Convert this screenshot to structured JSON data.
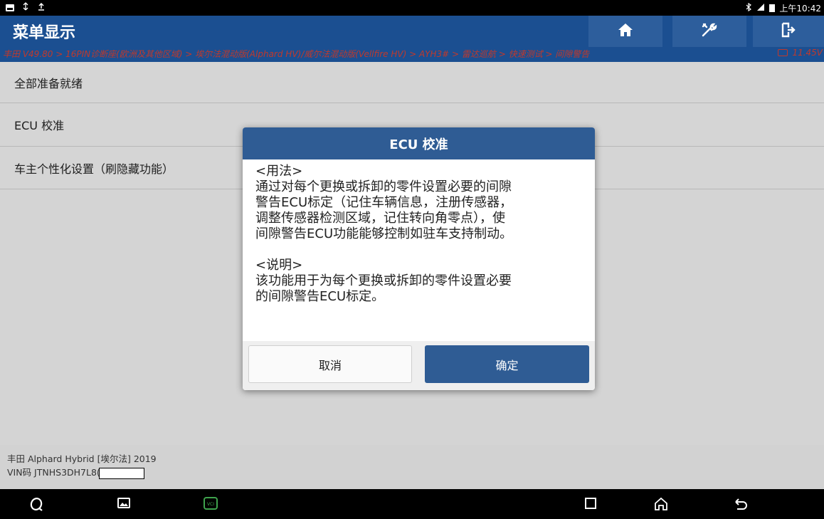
{
  "statusbar": {
    "time": "上午10:42",
    "left_icons": [
      "image-icon",
      "usb-icon",
      "upload-icon"
    ],
    "right_icons": [
      "bluetooth-icon",
      "signal-icon",
      "battery-icon"
    ]
  },
  "header": {
    "title": "菜单显示",
    "buttons": [
      "home-icon",
      "tools-icon",
      "exit-icon"
    ]
  },
  "breadcrumb": "丰田 V49.80 > 16PIN诊断座(欧洲及其他区域) > 埃尔法混动版(Alphard HV)/威尔法混动版(Vellfire HV) > AYH3# > 雷达巡航 > 快速测试 > 间隙警告",
  "voltage": "11.45V",
  "menu": {
    "items": [
      {
        "label": "全部准备就绪"
      },
      {
        "label": "ECU 校准"
      },
      {
        "label": "车主个性化设置（刷隐藏功能）"
      }
    ]
  },
  "footer": {
    "vehicle": "丰田 Alphard Hybrid [埃尔法] 2019",
    "vin": "VIN码 JTNHS3DH7L8("
  },
  "dialog": {
    "title": "ECU 校准",
    "usage_heading": "<用法>",
    "usage_lines": [
      "通过对每个更换或拆卸的零件设置必要的间隙",
      "警告ECU标定（记住车辆信息，注册传感器，",
      "调整传感器检测区域，记住转向角零点），使",
      "间隙警告ECU功能能够控制如驻车支持制动。"
    ],
    "note_heading": "<说明>",
    "note_lines": [
      "该功能用于为每个更换或拆卸的零件设置必要",
      "的间隙警告ECU标定。"
    ],
    "cancel_label": "取消",
    "ok_label": "确定"
  },
  "navbar": {
    "icons": [
      "browser-icon",
      "gallery-icon",
      "vci-icon",
      "recents-icon",
      "home-nav-icon",
      "back-icon"
    ]
  },
  "colors": {
    "header_bg": "#1b4f91",
    "header_button_bg": "#2d5e9c",
    "breadcrumb_text": "#c0392b",
    "dialog_title_bg": "#2f5c94",
    "vci_icon": "#3fa34d"
  }
}
